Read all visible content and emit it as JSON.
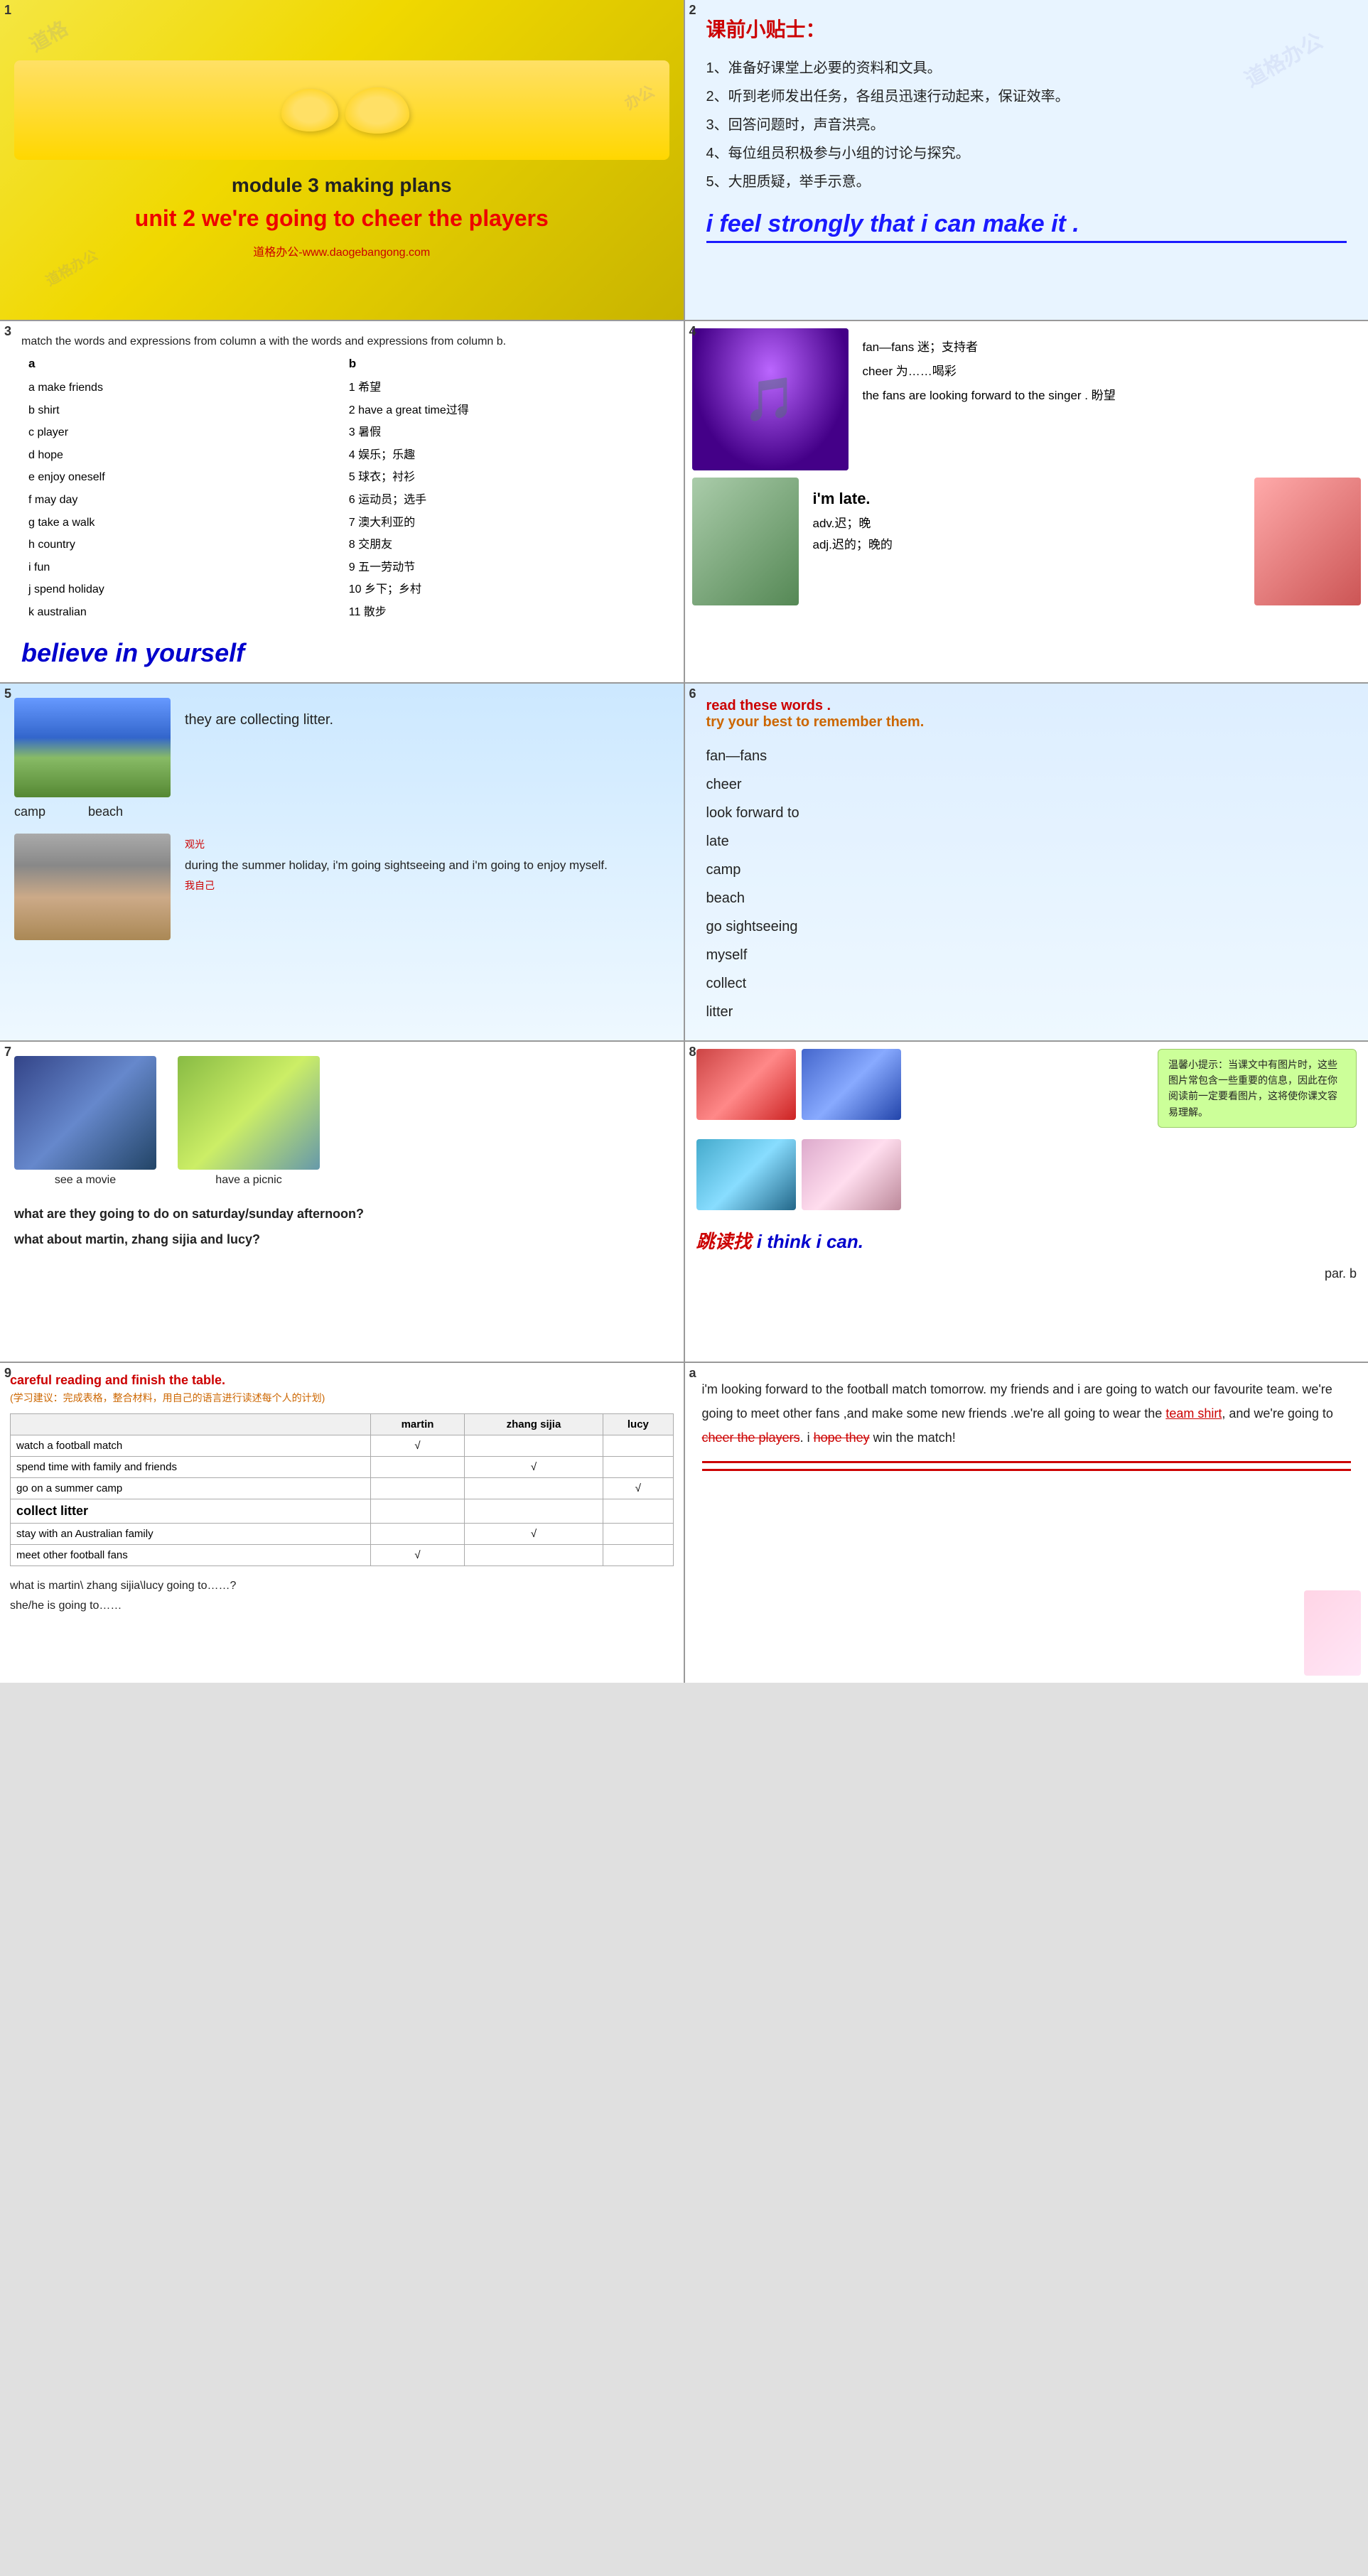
{
  "cells": {
    "cell1": {
      "number": "1",
      "module": "module 3 making plans",
      "unit": "unit 2 we're going to cheer the players",
      "website": "道格办公-www.daogebangong.com"
    },
    "cell2": {
      "number": "2",
      "tip_title": "课前小贴士：",
      "tips": [
        "1、准备好课堂上必要的资料和文具。",
        "2、听到老师发出任务，各组员迅速行动起来，保证效率。",
        "3、回答问题时，声音洪亮。",
        "4、每位组员积极参与小组的讨论与探究。",
        "5、大胆质疑，举手示意。"
      ],
      "big_text": "i feel strongly that i can make it ."
    },
    "cell3": {
      "number": "3",
      "instructions": "match the words and expressions from column a with the words and expressions from column b.",
      "col_a_header": "a",
      "col_b_header": "b",
      "col_a": [
        "a  make friends",
        "b  shirt",
        "c  player",
        "d  hope",
        "e  enjoy oneself",
        "f  may day",
        "g  take a walk",
        "h  country",
        "i  fun",
        "j  spend holiday",
        "k  australian"
      ],
      "col_b": [
        "1 希望",
        "2 have a great time过得",
        "3 暑假",
        "4 娱乐；乐趣",
        "5 球衣；衬衫",
        "6 运动员；选手",
        "7 澳大利亚的",
        "8 交朋友",
        "9 五一劳动节",
        "10 乡下；乡村",
        "11 散步"
      ],
      "big_text": "believe in yourself"
    },
    "cell4": {
      "number": "4",
      "vocab": [
        "fan—fans  迷；支持者",
        "cheer    为……喝彩",
        "the fans  are looking forward to the singer .    盼望"
      ],
      "late_text": "i'm late.",
      "late_adv": "adv.迟；晚",
      "late_adj": "adj.迟的；晚的"
    },
    "cell5": {
      "number": "5",
      "collect_text": "they are collecting  litter.",
      "labels": [
        "camp",
        "beach"
      ],
      "sightseeing": "during the summer holiday, i'm going sightseeing and i'm going to enjoy myself.",
      "sightseeing_note": "观光",
      "myself_note": "我自己"
    },
    "cell6": {
      "number": "6",
      "title1": "read these words .",
      "title2": "try your best to remember them.",
      "words": [
        "fan—fans",
        "cheer",
        "look forward to",
        "late",
        "camp",
        "beach",
        "go sightseeing",
        "myself",
        "collect",
        "litter"
      ]
    },
    "cell7": {
      "number": "7",
      "label_movie": "see a movie",
      "label_picnic": "have a picnic",
      "question1": "what are they going to do on saturday/sunday afternoon?",
      "question2": "what about martin, zhang sijia and lucy?"
    },
    "cell8": {
      "number": "8",
      "tip": "温馨小提示：当课文中有图片时，这些图片常包含一些重要的信息，因此在你阅读前一定要看图片，这将使你课文容易理解。",
      "skim_title": "跳读找",
      "skim_subtitle": "i think i can.",
      "par_b": "par. b"
    },
    "cell9": {
      "number": "9",
      "title": "careful reading and finish the table.",
      "subtitle": "(学习建议：完成表格，整合材料，用自己的语言进行读述每个人的计划)",
      "headers": [
        "",
        "martin",
        "zhang sijia",
        "lucy"
      ],
      "rows": [
        {
          "activity": "watch a football match",
          "martin": "√",
          "zhang": "",
          "lucy": ""
        },
        {
          "activity": "spend time with family and friends",
          "martin": "",
          "zhang": "√",
          "lucy": ""
        },
        {
          "activity": "go on a summer camp",
          "martin": "",
          "zhang": "",
          "lucy": "√"
        },
        {
          "activity": "collect litter",
          "martin": "",
          "zhang": "",
          "lucy": "",
          "bold": true
        },
        {
          "activity": "stay with an Australian family",
          "martin": "",
          "zhang": "√",
          "lucy": ""
        },
        {
          "activity": "meet other football fans",
          "martin": "√",
          "zhang": "",
          "lucy": ""
        }
      ],
      "question1": "what is martin\\ zhang sijia\\lucy going to……?",
      "question2": "she/he is going to……"
    },
    "cell10": {
      "number": "a",
      "passage": "i'm looking forward to the football match tomorrow. my friends and i are going to watch our favourite team. we're going to meet other fans ,and make some new friends .we're all going to wear the team shirt, and we're going to cheer the players. i hope they win the match!"
    }
  }
}
